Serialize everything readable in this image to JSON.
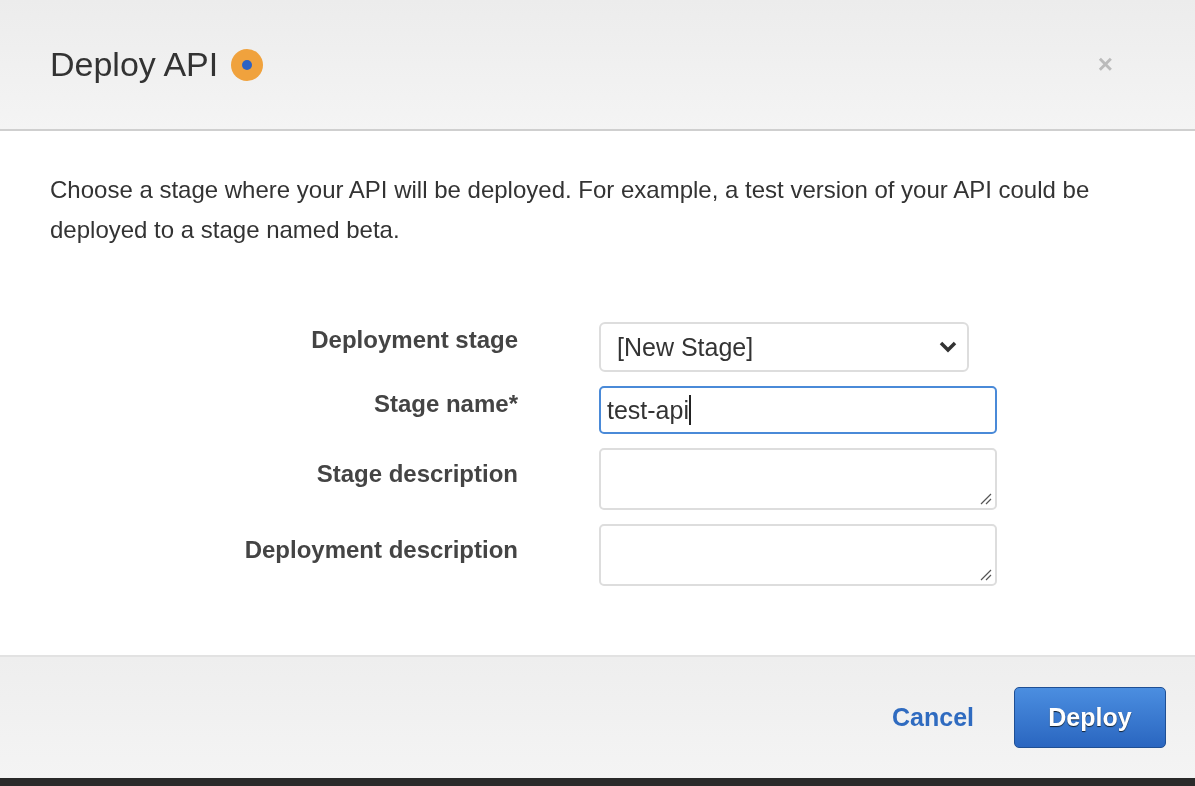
{
  "dialog": {
    "title": "Deploy API",
    "close": "×"
  },
  "intro": "Choose a stage where your API will be deployed. For example, a test version of your API could be deployed to a stage named beta.",
  "fields": [
    {
      "label": "Deployment stage",
      "kind": "select",
      "value": "[New Stage]",
      "focused": false
    },
    {
      "label": "Stage name*",
      "kind": "input",
      "value": "test-api",
      "focused": true
    },
    {
      "label": "Stage description",
      "kind": "textarea",
      "focused": false
    },
    {
      "label": "Deployment description",
      "kind": "textarea",
      "focused": false
    }
  ],
  "buttons": [
    {
      "label": "Cancel",
      "kind": "link"
    },
    {
      "label": "Deploy",
      "kind": "primary"
    }
  ]
}
